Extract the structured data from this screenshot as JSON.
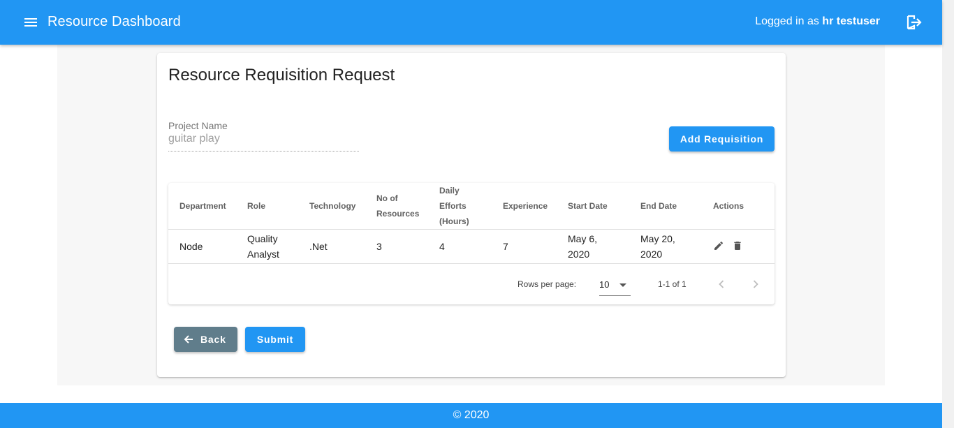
{
  "appbar": {
    "title": "Resource Dashboard",
    "logged_in_prefix": "Logged in as",
    "username": "hr testuser",
    "icons": [
      "menu-icon",
      "logout-icon"
    ],
    "color": "#2196f3"
  },
  "page": {
    "title": "Resource Requisition Request",
    "project_label": "Project Name",
    "project_value": "guitar play",
    "add_button": "Add Requisition"
  },
  "table": {
    "headers": {
      "department": "Department",
      "role": "Role",
      "technology": "Technology",
      "resources_1": "No of",
      "resources_2": "Resources",
      "efforts_1": "Daily",
      "efforts_2": "Efforts",
      "efforts_3": "(Hours)",
      "experience": "Experience",
      "start_date": "Start Date",
      "end_date": "End Date",
      "actions": "Actions"
    },
    "rows": [
      {
        "department": "Node",
        "role_1": "Quality",
        "role_2": "Analyst",
        "technology": ".Net",
        "resources": "3",
        "efforts": "4",
        "experience": "7",
        "start_1": "May 6,",
        "start_2": "2020",
        "end_1": "May 20,",
        "end_2": "2020",
        "actions": [
          "edit-icon",
          "delete-icon"
        ]
      }
    ],
    "pagination": {
      "rows_per_page_label": "Rows per page:",
      "rows_per_page": "10",
      "range": "1-1 of 1"
    }
  },
  "buttons": {
    "back": "Back",
    "submit": "Submit",
    "back_color": "#607d8b",
    "submit_color": "#2196f3"
  },
  "footer": {
    "text": "© 2020"
  }
}
